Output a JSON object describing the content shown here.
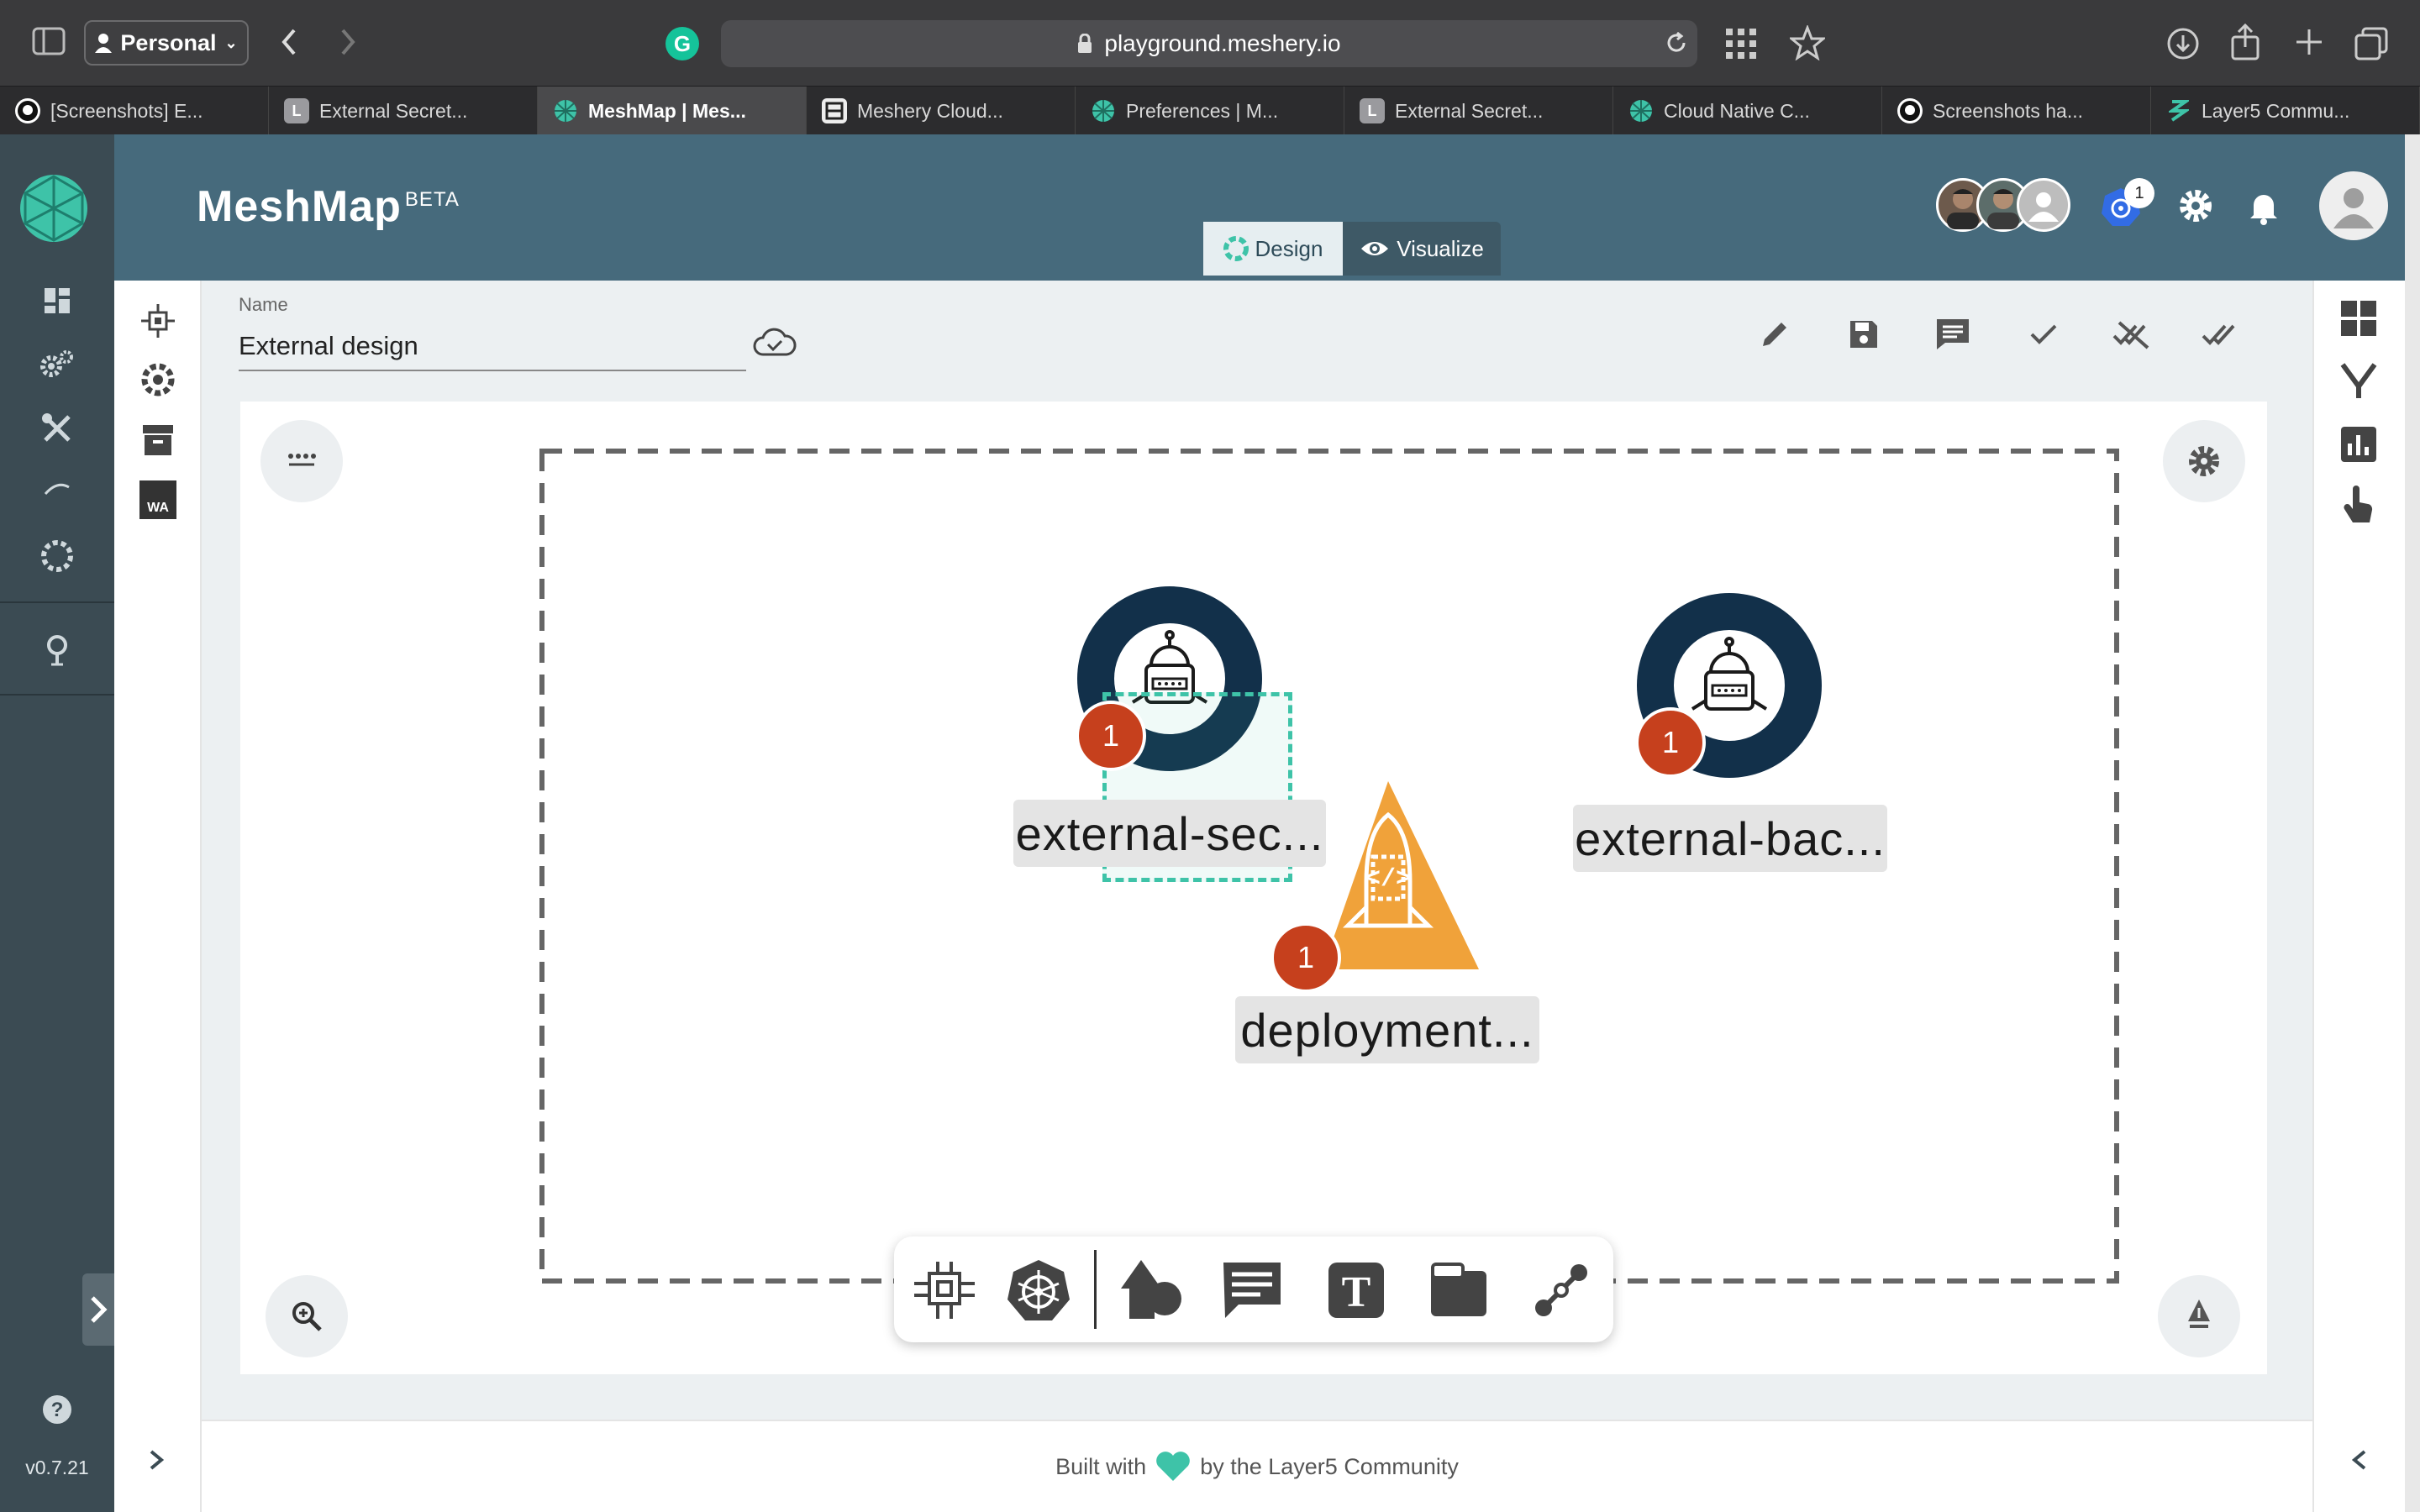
{
  "browser": {
    "profile_label": "Personal",
    "url": "playground.meshery.io",
    "tabs": [
      {
        "label": "[Screenshots] E...",
        "icon": "github-icon"
      },
      {
        "label": "External Secret...",
        "icon": "letter-l-icon"
      },
      {
        "label": "MeshMap | Mes...",
        "icon": "meshery-icon",
        "active": true
      },
      {
        "label": "Meshery Cloud...",
        "icon": "meshery-cloud-icon"
      },
      {
        "label": "Preferences | M...",
        "icon": "meshery-icon"
      },
      {
        "label": "External Secret...",
        "icon": "letter-l-icon"
      },
      {
        "label": "Cloud Native C...",
        "icon": "meshery-icon"
      },
      {
        "label": "Screenshots ha...",
        "icon": "github-icon"
      },
      {
        "label": "Layer5 Commu...",
        "icon": "layer5-icon"
      }
    ],
    "tab_letter": "L"
  },
  "app": {
    "title": "MeshMap",
    "title_badge": "BETA",
    "mode_toggle": {
      "design": "Design",
      "visualize": "Visualize",
      "selected": "Design"
    },
    "notification_count": "1",
    "version": "v0.7.21"
  },
  "design": {
    "name_label": "Name",
    "name_value": "External design"
  },
  "nodes": [
    {
      "label": "external-sec...",
      "badge": "1"
    },
    {
      "label": "deployment...",
      "badge": "1"
    },
    {
      "label": "external-bac...",
      "badge": "1"
    }
  ],
  "subnav": {
    "wa_label": "WA"
  },
  "footer": {
    "prefix": "Built with",
    "suffix": "by the Layer5 Community"
  },
  "colors": {
    "header": "#466a7c",
    "leftnav": "#3b4b53",
    "accent_teal": "#3ec3a8",
    "badge_red": "#c6401d",
    "node_navy": "#12304a",
    "deployment_orange": "#f0a23a"
  }
}
